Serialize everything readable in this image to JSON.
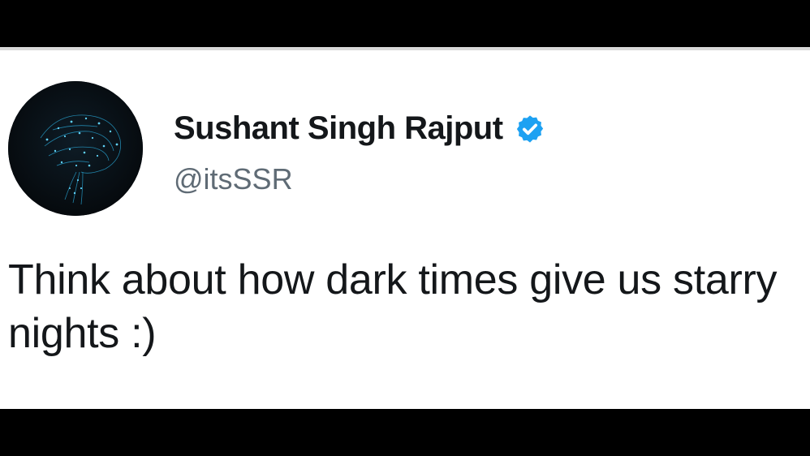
{
  "tweet": {
    "author": {
      "display_name": "Sushant Singh Rajput",
      "handle": "@itsSSR",
      "verified": true,
      "avatar_icon": "brain-network-icon",
      "verified_icon": "verified-badge-icon"
    },
    "text": "Think about how dark times give us starry nights :)"
  },
  "colors": {
    "background_bars": "#000000",
    "card": "#ffffff",
    "text_primary": "#14171a",
    "text_secondary": "#5f6b75",
    "verified_blue": "#1da1f2",
    "avatar_glow": "#2aa9d8"
  }
}
